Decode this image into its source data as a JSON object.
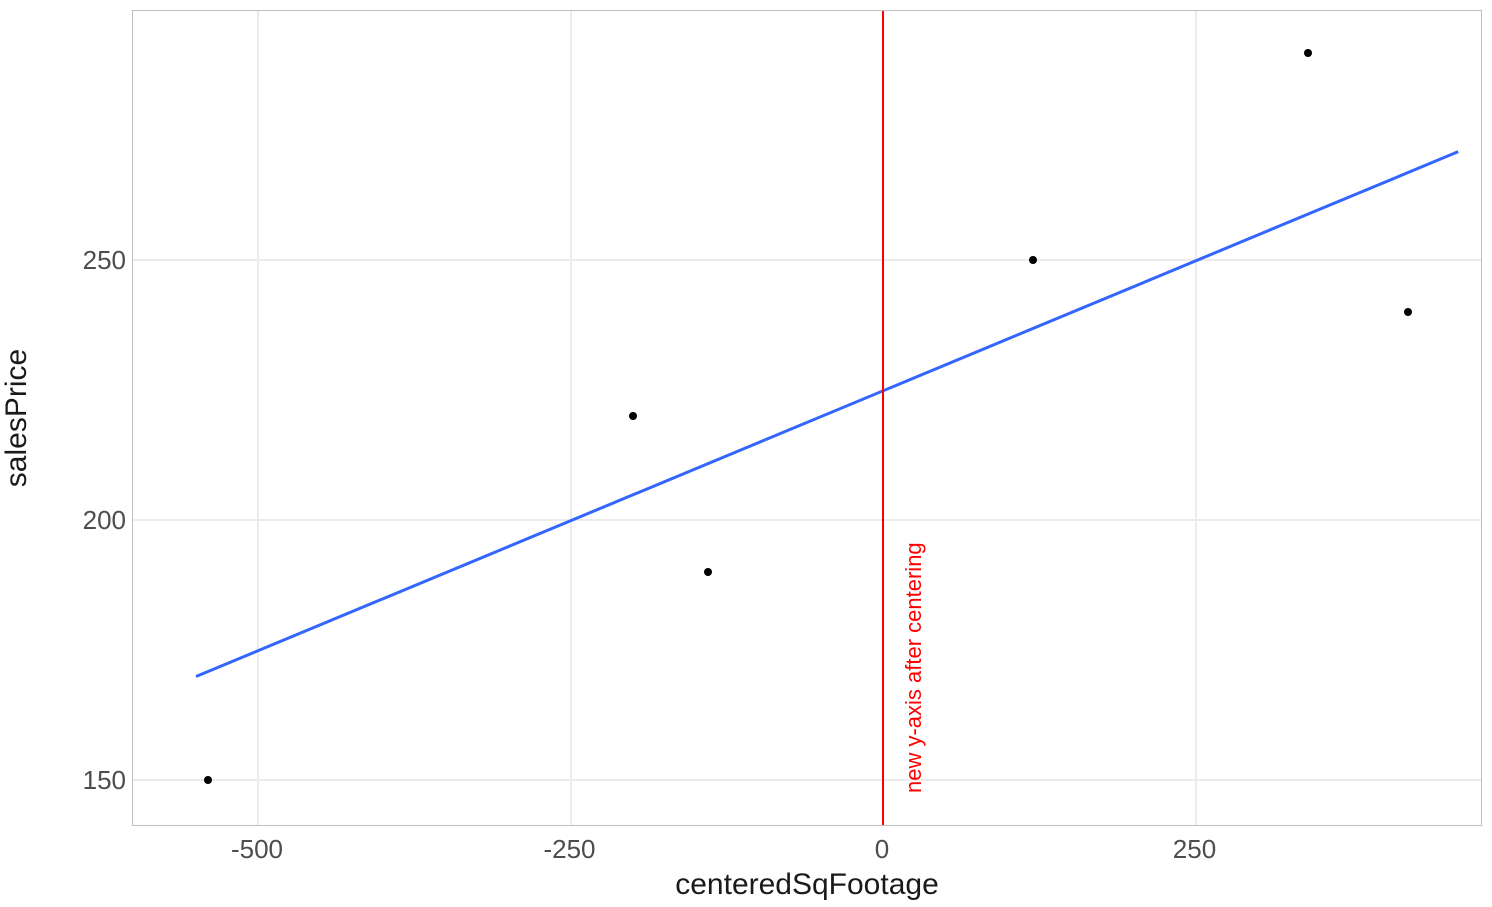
{
  "chart_data": {
    "type": "scatter",
    "title": "",
    "xlabel": "centeredSqFootage",
    "ylabel": "salesPrice",
    "xlim": [
      -600,
      480
    ],
    "ylim": [
      141,
      298
    ],
    "x_ticks": [
      -500,
      -250,
      0,
      250
    ],
    "y_ticks": [
      150,
      200,
      250
    ],
    "points": [
      {
        "x": -540,
        "y": 150
      },
      {
        "x": -200,
        "y": 220
      },
      {
        "x": -140,
        "y": 190
      },
      {
        "x": 120,
        "y": 250
      },
      {
        "x": 340,
        "y": 290
      },
      {
        "x": 420,
        "y": 240
      }
    ],
    "regression": {
      "slope": 0.1,
      "intercept": 225,
      "x1": -550,
      "x2": 460
    },
    "vline_x": 0,
    "annotation": {
      "text": "new y-axis after centering",
      "x": 25,
      "y": 150,
      "rotate_deg": 90,
      "color": "#ff0000"
    }
  }
}
